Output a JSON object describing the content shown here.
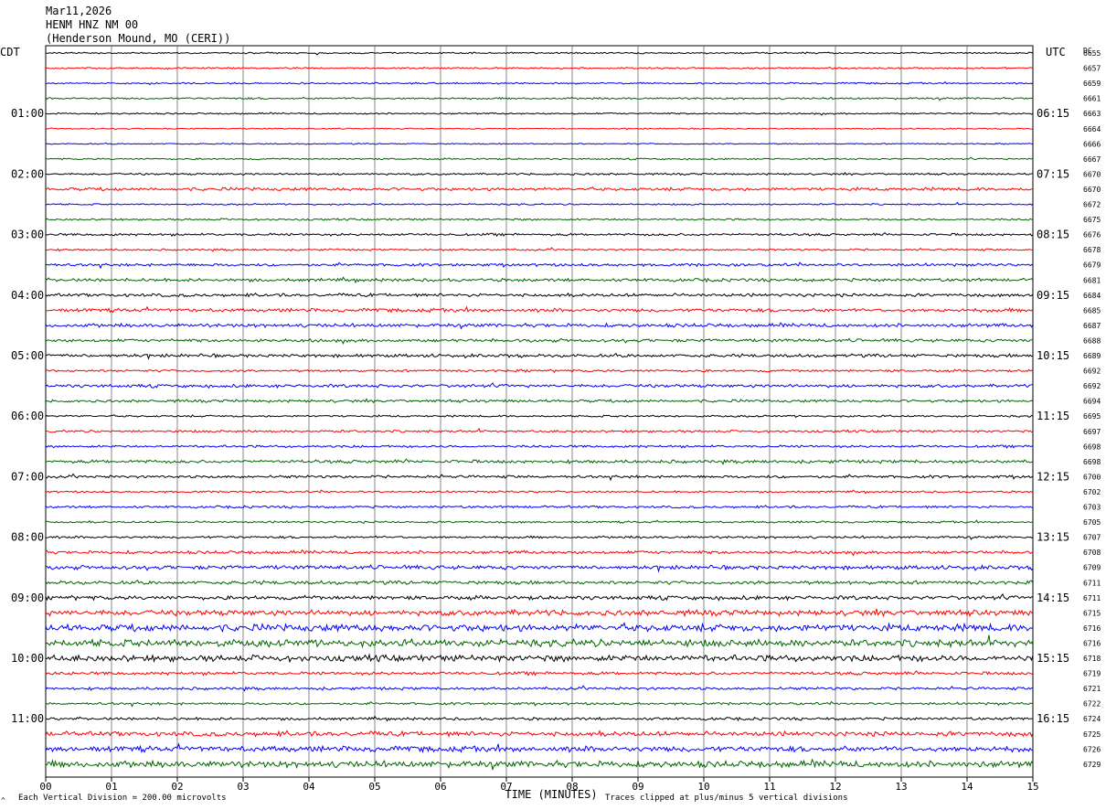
{
  "header": {
    "date": "Mar11,2026",
    "station": "HENM HNZ NM 00",
    "location": "(Henderson Mound, MO (CERI))"
  },
  "left_timezone": "CDT",
  "right_timezone": "UTC",
  "dc_header": "DC",
  "footer": {
    "scale_note": "Each Vertical Division =  200.00 microvolts",
    "clip_note": "Traces clipped at plus/minus 5 vertical divisions",
    "corner_mark": "^"
  },
  "colors": {
    "cycle": [
      "#000000",
      "#ff0000",
      "#0000ff",
      "#006400"
    ],
    "grid": "#555555"
  },
  "chart_data": {
    "type": "line",
    "subtype": "helicorder",
    "xlabel": "TIME (MINUTES)",
    "xlim": [
      0,
      15
    ],
    "x_ticks": [
      "00",
      "01",
      "02",
      "03",
      "04",
      "05",
      "06",
      "07",
      "08",
      "09",
      "10",
      "11",
      "12",
      "13",
      "14",
      "15"
    ],
    "left_hour_labels": [
      "01:00",
      "02:00",
      "03:00",
      "04:00",
      "05:00",
      "06:00",
      "07:00",
      "08:00",
      "09:00",
      "10:00",
      "11:00"
    ],
    "right_hour_labels": [
      "06:15",
      "07:15",
      "08:15",
      "09:15",
      "10:15",
      "11:15",
      "12:15",
      "13:15",
      "14:15",
      "15:15",
      "16:15"
    ],
    "dc_offsets": [
      6655,
      6657,
      6659,
      6661,
      6663,
      6664,
      6666,
      6667,
      6670,
      6670,
      6672,
      6675,
      6676,
      6678,
      6679,
      6681,
      6684,
      6685,
      6687,
      6688,
      6689,
      6692,
      6692,
      6694,
      6695,
      6697,
      6698,
      6698,
      6700,
      6702,
      6703,
      6705,
      6707,
      6708,
      6709,
      6711,
      6711,
      6715,
      6716,
      6716,
      6718,
      6719,
      6721,
      6722,
      6724,
      6725,
      6726,
      6729
    ],
    "trace_amplitude": [
      2,
      2,
      2,
      2.5,
      2,
      1.5,
      1.5,
      2,
      2.5,
      4,
      2,
      2.5,
      3,
      2.5,
      3.5,
      4,
      4,
      4.5,
      4.5,
      4,
      4,
      3,
      4,
      3.5,
      2.5,
      3,
      3,
      4,
      3.5,
      2.5,
      3,
      2.5,
      3,
      4,
      5,
      4.5,
      5,
      7,
      9,
      9,
      8,
      4,
      3.5,
      3,
      3.5,
      6,
      7,
      8
    ]
  }
}
